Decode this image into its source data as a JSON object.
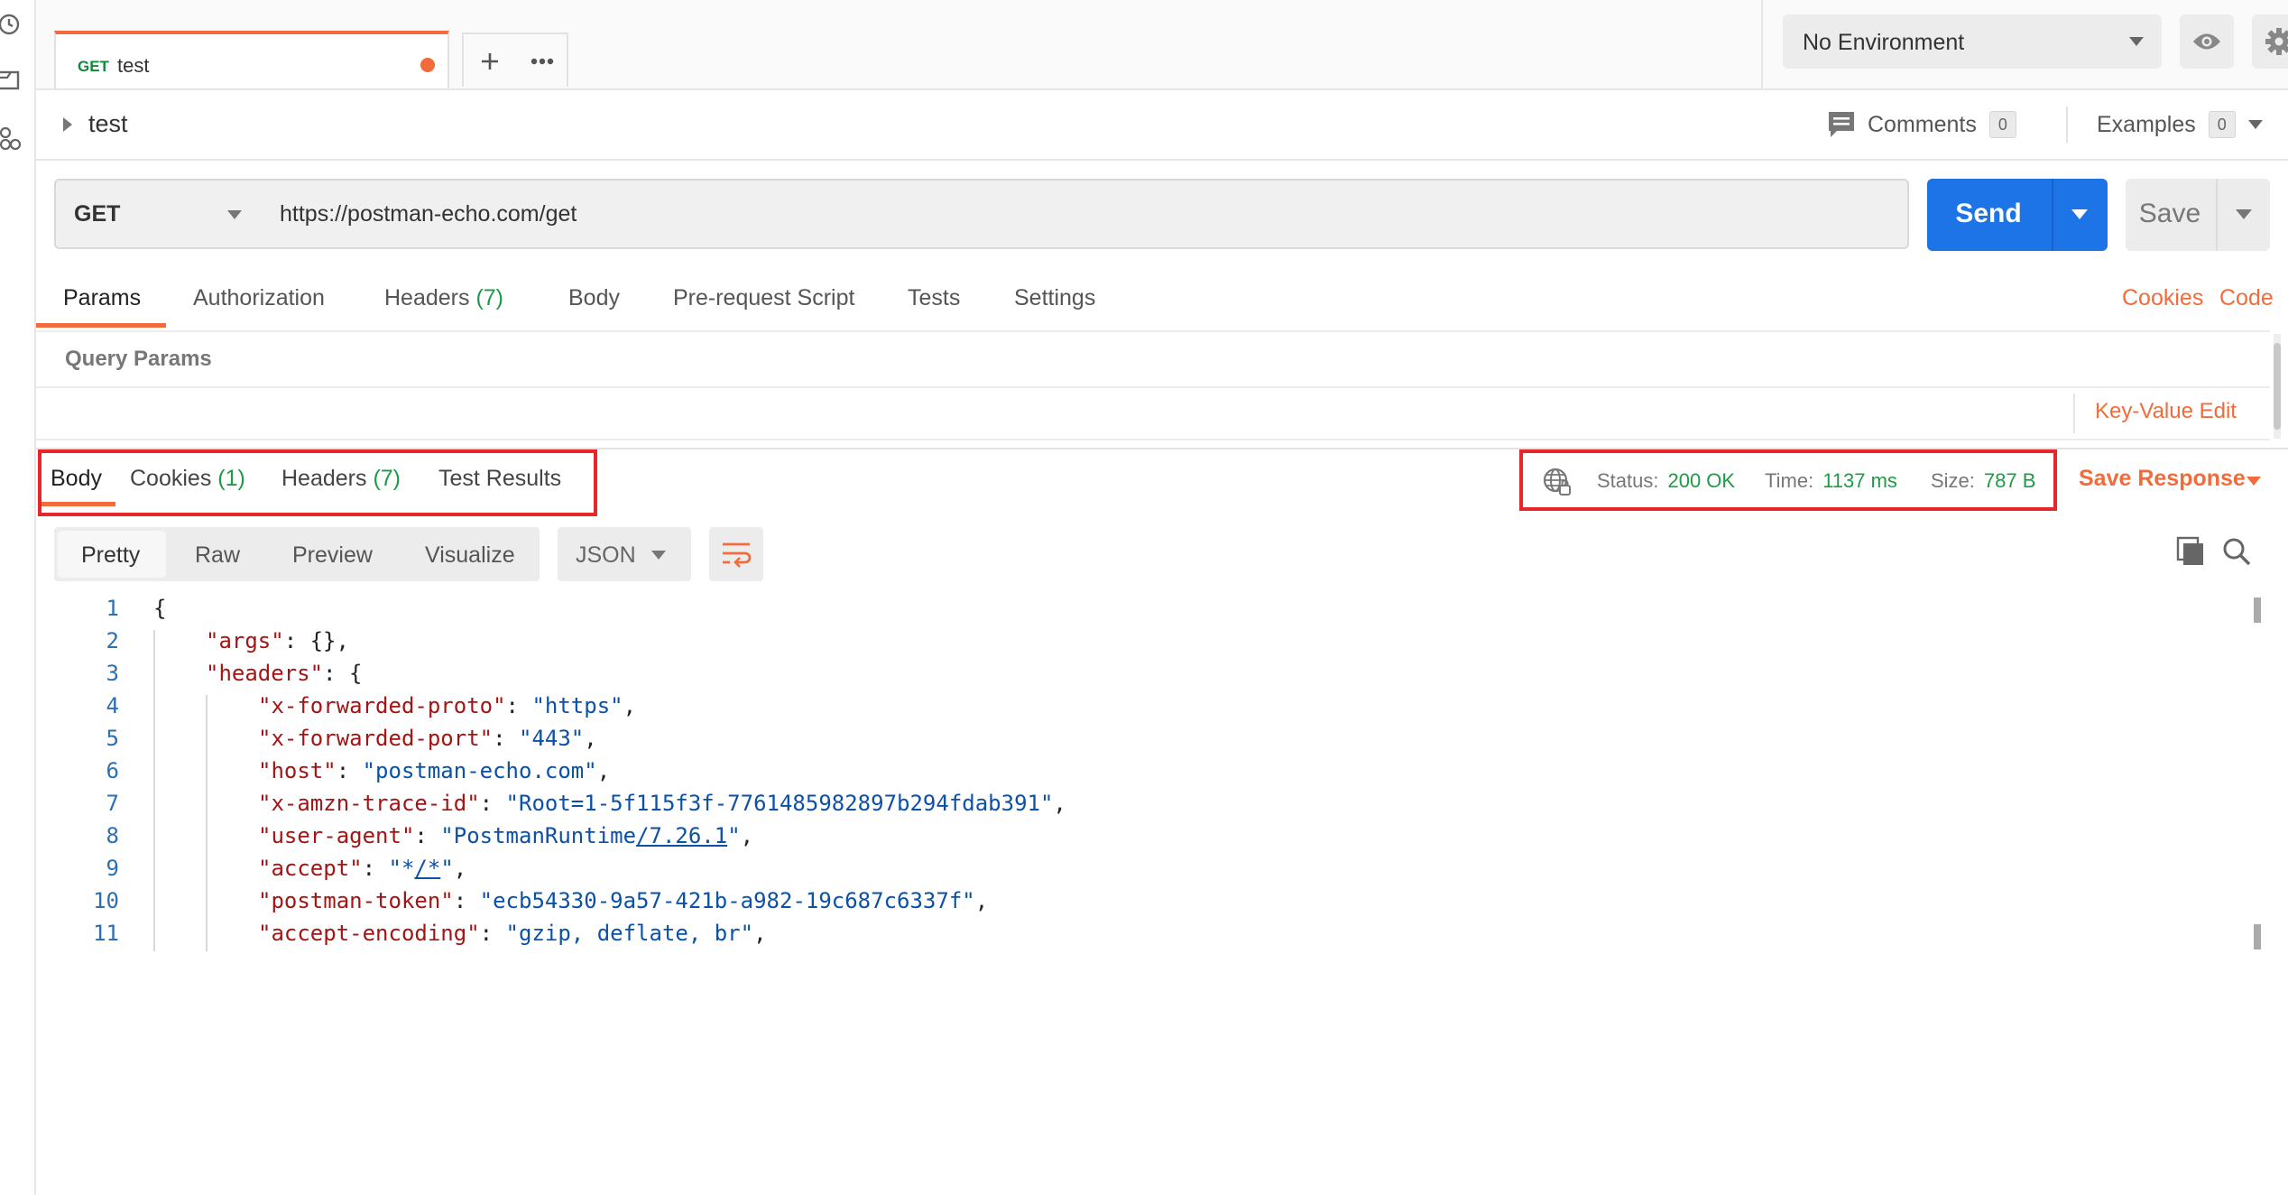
{
  "rail": {
    "icons": [
      "history-icon",
      "collections-icon",
      "apis-icon"
    ]
  },
  "tab": {
    "method": "GET",
    "name": "test"
  },
  "environment": {
    "selected": "No Environment"
  },
  "request": {
    "title": "test",
    "comments_label": "Comments",
    "comments_count": "0",
    "examples_label": "Examples",
    "examples_count": "0",
    "method": "GET",
    "url": "https://postman-echo.com/get",
    "send_label": "Send",
    "save_label": "Save"
  },
  "request_tabs": {
    "params": "Params",
    "authorization": "Authorization",
    "headers": "Headers",
    "headers_count": "(7)",
    "body": "Body",
    "prerequest": "Pre-request Script",
    "tests": "Tests",
    "settings": "Settings",
    "cookies_link": "Cookies",
    "code_link": "Code"
  },
  "query_params": {
    "title": "Query Params",
    "key_value_edit": "Key-Value Edit"
  },
  "response_tabs": {
    "body": "Body",
    "cookies": "Cookies",
    "cookies_count": "(1)",
    "headers": "Headers",
    "headers_count": "(7)",
    "test_results": "Test Results"
  },
  "response_status": {
    "status_label": "Status:",
    "status_value": "200 OK",
    "time_label": "Time:",
    "time_value": "1137 ms",
    "size_label": "Size:",
    "size_value": "787 B",
    "save_response": "Save Response"
  },
  "body_view": {
    "modes": [
      "Pretty",
      "Raw",
      "Preview",
      "Visualize"
    ],
    "format": "JSON"
  },
  "code_lines": [
    {
      "n": "1",
      "indent": 0,
      "parts": [
        {
          "t": "{",
          "c": "p"
        }
      ]
    },
    {
      "n": "2",
      "indent": 1,
      "parts": [
        {
          "t": "\"args\"",
          "c": "k"
        },
        {
          "t": ": {},",
          "c": "p"
        }
      ]
    },
    {
      "n": "3",
      "indent": 1,
      "parts": [
        {
          "t": "\"headers\"",
          "c": "k"
        },
        {
          "t": ": {",
          "c": "p"
        }
      ]
    },
    {
      "n": "4",
      "indent": 2,
      "parts": [
        {
          "t": "\"x-forwarded-proto\"",
          "c": "k"
        },
        {
          "t": ": ",
          "c": "p"
        },
        {
          "t": "\"https\"",
          "c": "s"
        },
        {
          "t": ",",
          "c": "p"
        }
      ]
    },
    {
      "n": "5",
      "indent": 2,
      "parts": [
        {
          "t": "\"x-forwarded-port\"",
          "c": "k"
        },
        {
          "t": ": ",
          "c": "p"
        },
        {
          "t": "\"443\"",
          "c": "s"
        },
        {
          "t": ",",
          "c": "p"
        }
      ]
    },
    {
      "n": "6",
      "indent": 2,
      "parts": [
        {
          "t": "\"host\"",
          "c": "k"
        },
        {
          "t": ": ",
          "c": "p"
        },
        {
          "t": "\"postman-echo.com\"",
          "c": "s"
        },
        {
          "t": ",",
          "c": "p"
        }
      ]
    },
    {
      "n": "7",
      "indent": 2,
      "parts": [
        {
          "t": "\"x-amzn-trace-id\"",
          "c": "k"
        },
        {
          "t": ": ",
          "c": "p"
        },
        {
          "t": "\"Root=1-5f115f3f-7761485982897b294fdab391\"",
          "c": "s"
        },
        {
          "t": ",",
          "c": "p"
        }
      ]
    },
    {
      "n": "8",
      "indent": 2,
      "parts": [
        {
          "t": "\"user-agent\"",
          "c": "k"
        },
        {
          "t": ": ",
          "c": "p"
        },
        {
          "t": "\"PostmanRuntime",
          "c": "s"
        },
        {
          "t": "/7.26.1",
          "c": "u"
        },
        {
          "t": "\"",
          "c": "s"
        },
        {
          "t": ",",
          "c": "p"
        }
      ]
    },
    {
      "n": "9",
      "indent": 2,
      "parts": [
        {
          "t": "\"accept\"",
          "c": "k"
        },
        {
          "t": ": ",
          "c": "p"
        },
        {
          "t": "\"*",
          "c": "s"
        },
        {
          "t": "/*",
          "c": "u"
        },
        {
          "t": "\"",
          "c": "s"
        },
        {
          "t": ",",
          "c": "p"
        }
      ]
    },
    {
      "n": "10",
      "indent": 2,
      "parts": [
        {
          "t": "\"postman-token\"",
          "c": "k"
        },
        {
          "t": ": ",
          "c": "p"
        },
        {
          "t": "\"ecb54330-9a57-421b-a982-19c687c6337f\"",
          "c": "s"
        },
        {
          "t": ",",
          "c": "p"
        }
      ]
    },
    {
      "n": "11",
      "indent": 2,
      "parts": [
        {
          "t": "\"accept-encoding\"",
          "c": "k"
        },
        {
          "t": ": ",
          "c": "p"
        },
        {
          "t": "\"gzip, deflate, br\"",
          "c": "s"
        },
        {
          "t": ",",
          "c": "p"
        }
      ]
    }
  ],
  "colors": {
    "accent": "#f26b3a",
    "send": "#1d74e6",
    "ok": "#1e9b47",
    "highlight_box": "#e5262b"
  }
}
